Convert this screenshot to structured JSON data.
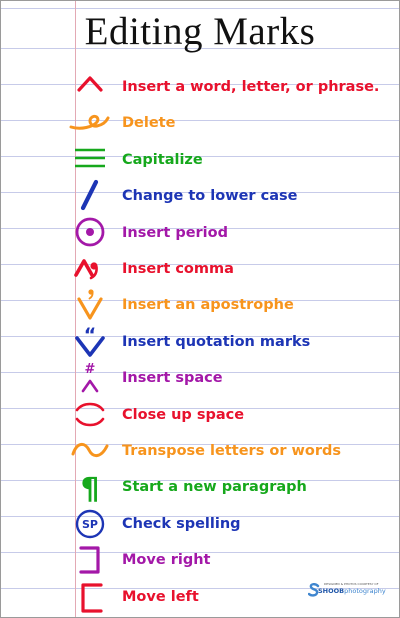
{
  "title": "Editing Marks",
  "marks": [
    {
      "icon": "caret-icon",
      "label": "Insert a word, letter, or phrase.",
      "color": "#e8112d"
    },
    {
      "icon": "delete-loop-icon",
      "label": "Delete",
      "color": "#f7941d"
    },
    {
      "icon": "triple-underline-icon",
      "label": "Capitalize",
      "color": "#16a81c"
    },
    {
      "icon": "slash-icon",
      "label": "Change to lower case",
      "color": "#1d35b5"
    },
    {
      "icon": "circled-period-icon",
      "label": "Insert period",
      "color": "#a318a8"
    },
    {
      "icon": "comma-caret-icon",
      "label": "Insert comma",
      "color": "#e8112d"
    },
    {
      "icon": "apostrophe-caret-icon",
      "label": "Insert an apostrophe",
      "color": "#f7941d"
    },
    {
      "icon": "quotation-caret-icon",
      "label": "Insert quotation marks",
      "color": "#1d35b5"
    },
    {
      "icon": "space-caret-icon",
      "label": "Insert space",
      "color": "#a318a8"
    },
    {
      "icon": "close-up-arc-icon",
      "label": "Close up space",
      "color": "#e8112d"
    },
    {
      "icon": "transpose-wave-icon",
      "label": "Transpose letters or words",
      "color": "#f7941d"
    },
    {
      "icon": "paragraph-icon",
      "label": "Start a new paragraph",
      "color": "#16a81c"
    },
    {
      "icon": "sp-circle-icon",
      "label": "Check spelling",
      "color": "#1d35b5"
    },
    {
      "icon": "right-bracket-icon",
      "label": "Move right",
      "color": "#a318a8"
    },
    {
      "icon": "left-bracket-icon",
      "label": "Move left",
      "color": "#e8112d"
    }
  ],
  "credit": {
    "small_text": "DESIGNED & PHOTOS COURTESY OF",
    "brand_bold": "SHOOB",
    "brand_light": "photography",
    "brand_color": "#1e55a8"
  }
}
